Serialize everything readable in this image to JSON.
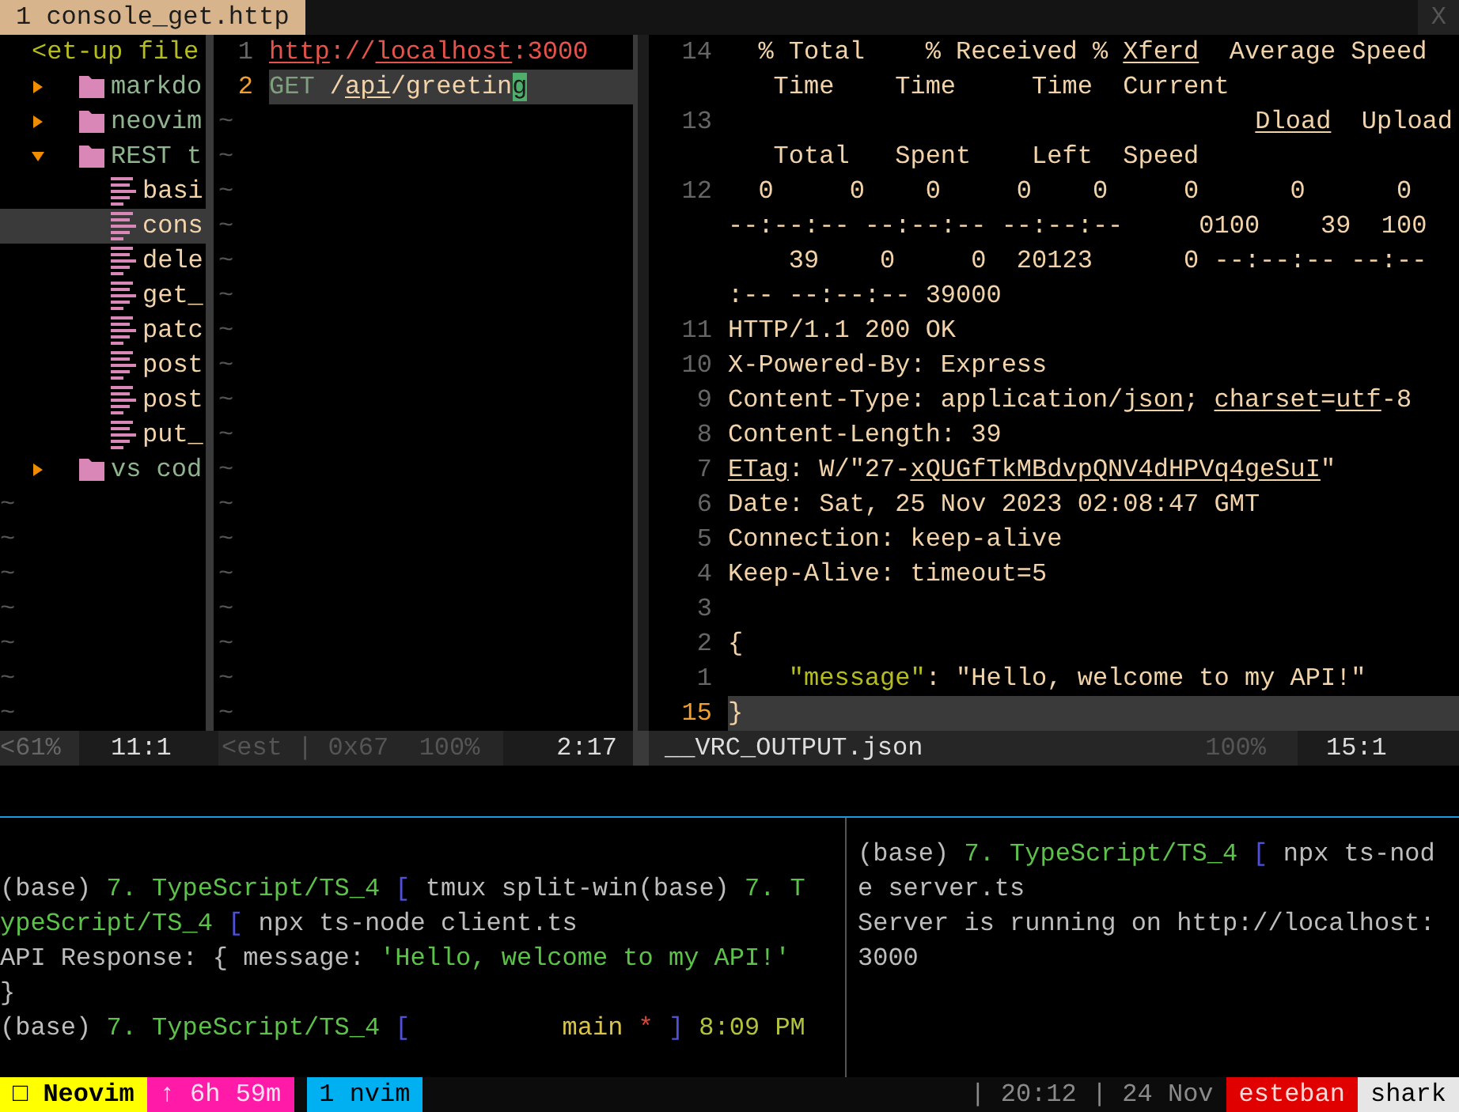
{
  "tabline": {
    "tabs": [
      {
        "label": "1 console_get.http",
        "selected": true
      }
    ],
    "close": "X"
  },
  "tree": {
    "header": "<et-up file",
    "items": [
      {
        "kind": "folder",
        "name": "markdo",
        "expanded": false,
        "selected": false
      },
      {
        "kind": "folder",
        "name": "neovim",
        "expanded": false,
        "selected": false
      },
      {
        "kind": "folder",
        "name": "REST t",
        "expanded": true,
        "selected": false,
        "children": [
          {
            "kind": "file",
            "name": "basi",
            "selected": false
          },
          {
            "kind": "file",
            "name": "cons",
            "selected": true
          },
          {
            "kind": "file",
            "name": "dele",
            "selected": false
          },
          {
            "kind": "file",
            "name": "get_",
            "selected": false
          },
          {
            "kind": "file",
            "name": "patc",
            "selected": false
          },
          {
            "kind": "file",
            "name": "post",
            "selected": false
          },
          {
            "kind": "file",
            "name": "post",
            "selected": false
          },
          {
            "kind": "file",
            "name": "put_",
            "selected": false
          }
        ]
      },
      {
        "kind": "folder",
        "name": "vs cod",
        "expanded": false,
        "selected": false
      }
    ],
    "empty_markers": [
      "~",
      "~",
      "~",
      "~",
      "~",
      "~",
      "~"
    ],
    "status": {
      "scroll": "<61%",
      "position": "11:1"
    }
  },
  "request": {
    "lines": [
      {
        "number": "1",
        "current": false,
        "segments": [
          {
            "kind": "url_link",
            "text": "http"
          },
          {
            "kind": "url",
            "text": "://"
          },
          {
            "kind": "url_link",
            "text": "localhost"
          },
          {
            "kind": "url",
            "text": ":3000"
          }
        ]
      },
      {
        "number": "2",
        "current": true,
        "segments": [
          {
            "kind": "method",
            "text": "GET "
          },
          {
            "kind": "path",
            "text": "/"
          },
          {
            "kind": "path_link",
            "text": "api"
          },
          {
            "kind": "path",
            "text": "/greetin"
          },
          {
            "kind": "cursor",
            "text": "g"
          }
        ]
      }
    ],
    "empty_markers": [
      "~",
      "~",
      "~",
      "~",
      "~",
      "~",
      "~",
      "~",
      "~",
      "~",
      "~",
      "~",
      "~",
      "~",
      "~",
      "~",
      "~",
      "~"
    ],
    "status": {
      "info": "<est | 0x67  100%",
      "position": "2:17"
    }
  },
  "response": {
    "rows": [
      {
        "kind": "line",
        "number": "14",
        "current": false,
        "segments": [
          {
            "kind": "text",
            "text": "  % Total    % Received % "
          },
          {
            "kind": "link",
            "text": "Xferd"
          },
          {
            "kind": "text",
            "text": "  Average Speed"
          }
        ]
      },
      {
        "kind": "line",
        "segments": [
          {
            "kind": "text",
            "text": "   Time    Time     Time  Current"
          }
        ]
      },
      {
        "kind": "right_line",
        "number": "13",
        "current": false,
        "segments": [
          {
            "kind": "link",
            "text": "Dload"
          },
          {
            "kind": "text",
            "text": "  Upload"
          }
        ]
      },
      {
        "kind": "line",
        "segments": [
          {
            "kind": "text",
            "text": "   Total   Spent    Left  Speed"
          }
        ]
      },
      {
        "kind": "line",
        "number": "12",
        "current": false,
        "segments": [
          {
            "kind": "text",
            "text": "  0     0    0     0    0     0      0      0"
          }
        ]
      },
      {
        "kind": "line",
        "segments": [
          {
            "kind": "text",
            "text": "--:--:-- --:--:-- --:--:--     0100    39  100"
          }
        ]
      },
      {
        "kind": "line",
        "segments": [
          {
            "kind": "text",
            "text": "    39    0     0  20123      0 --:--:-- --:--"
          }
        ]
      },
      {
        "kind": "line",
        "segments": [
          {
            "kind": "text",
            "text": ":-- --:--:-- 39000"
          }
        ]
      },
      {
        "kind": "line",
        "number": "11",
        "current": false,
        "segments": [
          {
            "kind": "text",
            "text": "HTTP/1.1 200 OK"
          }
        ]
      },
      {
        "kind": "line",
        "number": "10",
        "current": false,
        "segments": [
          {
            "kind": "text",
            "text": "X-Powered-By: Express"
          }
        ]
      },
      {
        "kind": "line",
        "number": "9",
        "current": false,
        "segments": [
          {
            "kind": "text",
            "text": "Content-Type: application/"
          },
          {
            "kind": "link",
            "text": "json"
          },
          {
            "kind": "text",
            "text": "; "
          },
          {
            "kind": "link",
            "text": "charset"
          },
          {
            "kind": "text",
            "text": "="
          },
          {
            "kind": "link",
            "text": "utf"
          },
          {
            "kind": "text",
            "text": "-8"
          }
        ]
      },
      {
        "kind": "line",
        "number": "8",
        "current": false,
        "segments": [
          {
            "kind": "text",
            "text": "Content-Length: 39"
          }
        ]
      },
      {
        "kind": "line",
        "number": "7",
        "current": false,
        "segments": [
          {
            "kind": "link",
            "text": "ETag"
          },
          {
            "kind": "text",
            "text": ": W/\"27-"
          },
          {
            "kind": "link",
            "text": "xQUGfTkMBdvpQNV4dHPVq4geSuI"
          },
          {
            "kind": "text",
            "text": "\""
          }
        ]
      },
      {
        "kind": "line",
        "number": "6",
        "current": false,
        "segments": [
          {
            "kind": "text",
            "text": "Date: Sat, 25 Nov 2023 02:08:47 GMT"
          }
        ]
      },
      {
        "kind": "line",
        "number": "5",
        "current": false,
        "segments": [
          {
            "kind": "text",
            "text": "Connection: keep-alive"
          }
        ]
      },
      {
        "kind": "line",
        "number": "4",
        "current": false,
        "segments": [
          {
            "kind": "text",
            "text": "Keep-Alive: timeout=5"
          }
        ]
      },
      {
        "kind": "line",
        "number": "3",
        "current": false
      },
      {
        "kind": "line",
        "number": "2",
        "current": false,
        "segments": [
          {
            "kind": "text",
            "text": "{"
          }
        ]
      },
      {
        "kind": "line",
        "number": "1",
        "current": false,
        "segments": [
          {
            "kind": "key",
            "text": "    \"message\""
          },
          {
            "kind": "text",
            "text": ": \"Hello, welcome to my API!\""
          }
        ]
      },
      {
        "kind": "line",
        "number": "15",
        "current": true,
        "segments": [
          {
            "kind": "text",
            "text": "}"
          }
        ]
      }
    ],
    "status": {
      "file": "__VRC_OUTPUT.json",
      "scroll": "100%",
      "position": "15:1"
    }
  },
  "terminal": {
    "left_pane": [
      [
        {
          "kind": "shell",
          "text": "(base) "
        },
        {
          "kind": "green",
          "text": "7. TypeScript/TS_4"
        },
        {
          "kind": "bracket",
          "text": " [ "
        },
        {
          "kind": "shell",
          "text": "tmux split-win(base) "
        },
        {
          "kind": "green",
          "text": "7. T"
        }
      ],
      [
        {
          "kind": "green",
          "text": "ypeScript/TS_4"
        },
        {
          "kind": "bracket",
          "text": " [ "
        },
        {
          "kind": "shell",
          "text": "npx ts-node client.ts"
        }
      ],
      [
        {
          "kind": "shell",
          "text": "API Response: { message: "
        },
        {
          "kind": "green",
          "text": "'Hello, welcome to my API!'"
        }
      ],
      [
        {
          "kind": "shell",
          "text": "}"
        }
      ],
      [
        {
          "kind": "shell",
          "text": "(base) "
        },
        {
          "kind": "green",
          "text": "7. TypeScript/TS_4"
        },
        {
          "kind": "bracket",
          "text": " ["
        },
        {
          "kind": "yellow",
          "text": "          main"
        },
        {
          "kind": "red",
          "text": " *"
        },
        {
          "kind": "bracket",
          "text": " ]"
        },
        {
          "kind": "time",
          "text": " 8:09 PM"
        }
      ]
    ],
    "right_pane": [
      [
        {
          "kind": "shell",
          "text": "(base) "
        },
        {
          "kind": "green",
          "text": "7. TypeScript/TS_4"
        },
        {
          "kind": "bracket",
          "text": " [ "
        },
        {
          "kind": "shell",
          "text": "npx ts-nod"
        }
      ],
      [
        {
          "kind": "shell",
          "text": "e server.ts"
        }
      ],
      [
        {
          "kind": "shell",
          "text": "Server is running on http://localhost:"
        }
      ],
      [
        {
          "kind": "shell",
          "text": "3000"
        }
      ]
    ]
  },
  "status_bar": {
    "left": [
      {
        "kind": "session",
        "text": "□ Neovim"
      },
      {
        "kind": "uptime",
        "text": "↑ 6h 59m"
      },
      {
        "kind": "window",
        "text": "1 nvim"
      }
    ],
    "right": [
      {
        "kind": "clock",
        "text": "| 20:12 | 24 Nov"
      },
      {
        "kind": "user",
        "text": "esteban"
      },
      {
        "kind": "host",
        "text": "shark"
      }
    ]
  }
}
